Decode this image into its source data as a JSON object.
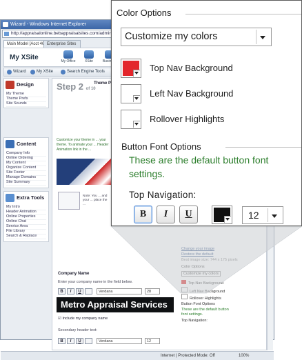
{
  "browser": {
    "title": "Wizard - Windows Internet Explorer",
    "address": "http://appraisalonline.bebappraisalsites.com/admin",
    "tabs": [
      "Main Model [Acct 46]",
      "Enterprise Sites"
    ],
    "status": "Internet | Protected Mode: Off",
    "zoom": "100%"
  },
  "app": {
    "name": "My XSite",
    "top_icons": [
      "My Office",
      "XSite",
      "Business"
    ],
    "toolbar": [
      "Wizard",
      "My XSite",
      "Search Engine Tools"
    ]
  },
  "sidebar": {
    "design": {
      "title": "Design",
      "items": [
        "My Theme",
        "Theme Prefs",
        "Site Sounds"
      ]
    },
    "content": {
      "title": "Content",
      "items": [
        "Company Info",
        "Online Ordering",
        "My Content",
        "Organize Content",
        "Site Footer",
        "Manage Domains",
        "Site Summary"
      ]
    },
    "extra": {
      "title": "Extra Tools",
      "items": [
        "My Intro",
        "Header Animation",
        "Online Properties",
        "Online Chat",
        "Service Area",
        "File Library",
        "Search & Replace"
      ]
    }
  },
  "content": {
    "step": "Step 2",
    "step_of": "of 10",
    "theme_tab": "Theme P",
    "intro": "Customize your theme in ... your theme. To animate your ... Header Animation link in the ...",
    "note": "Note: You ... and your ... place the ...",
    "company_name_label": "Company Name",
    "company_name_help": "Enter your company name in the field below.",
    "company_name_value": "Metro Appraisal Services",
    "font_value": "Verdana",
    "font_size_value": "28",
    "include_label": "Include my company name",
    "secondary_label": "Secondary header text:",
    "secondary_font": "Verdana",
    "secondary_size": "12",
    "right_links": [
      "Change your image",
      "Restore the default",
      "Best image size: 744 x 175 pixels"
    ],
    "right_color_options": "Color Options",
    "right_customize": "Customize my colors",
    "right_items": [
      "Top Nav Background",
      "Left Nav Background",
      "Rollover Highlights"
    ],
    "right_bfo": "Button Font Options",
    "right_note": "These are the default button font settings.",
    "right_topnav": "Top Navigation:"
  },
  "zoom": {
    "section_title": "Color Options",
    "customize_select": "Customize my colors",
    "color_items": [
      {
        "label": "Top Nav Background",
        "color": "#e3262b"
      },
      {
        "label": "Left Nav Background",
        "color": "#ffffff"
      },
      {
        "label": "Rollover Highlights",
        "color": "#ffffff"
      }
    ],
    "button_font_title": "Button Font Options",
    "default_note": "These are the default button font settings.",
    "top_nav_label": "Top Navigation:",
    "font_buttons": [
      "B",
      "I",
      "U"
    ],
    "font_color": "#111111",
    "font_size": "12"
  }
}
